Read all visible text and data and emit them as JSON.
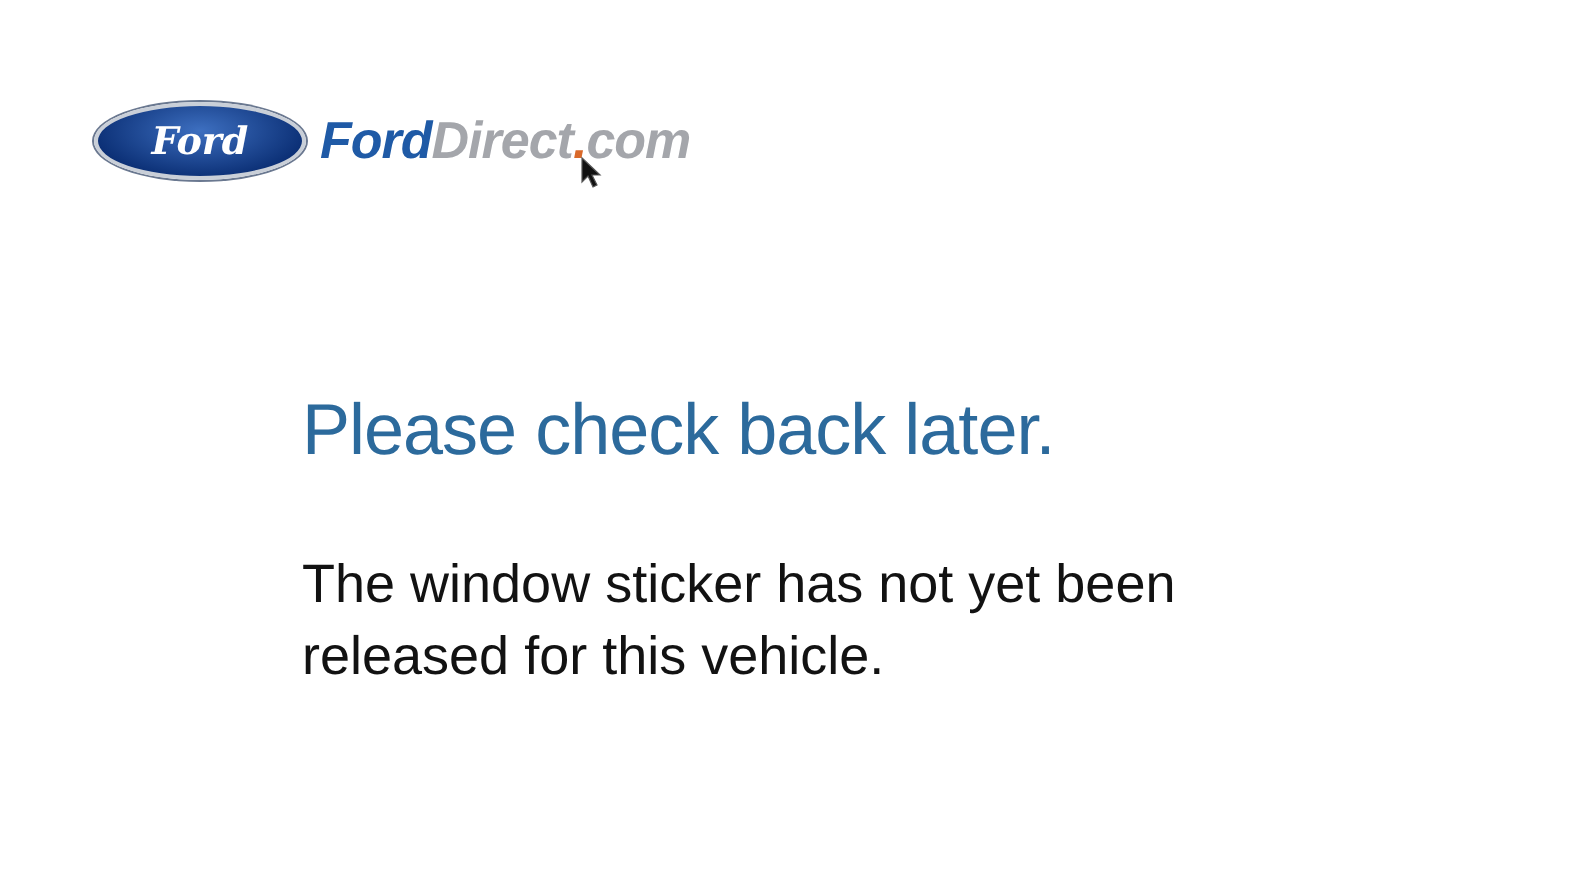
{
  "logo": {
    "emblem_text": "Ford",
    "wordmark": [
      {
        "text": "Ford",
        "kind": "brand"
      },
      {
        "text": "Direct",
        "kind": "muted"
      },
      {
        "text": ".",
        "kind": "dot"
      },
      {
        "text": "com",
        "kind": "muted"
      }
    ]
  },
  "heading": "Please check back later.",
  "message": "The window sticker has not yet been released for this vehicle."
}
